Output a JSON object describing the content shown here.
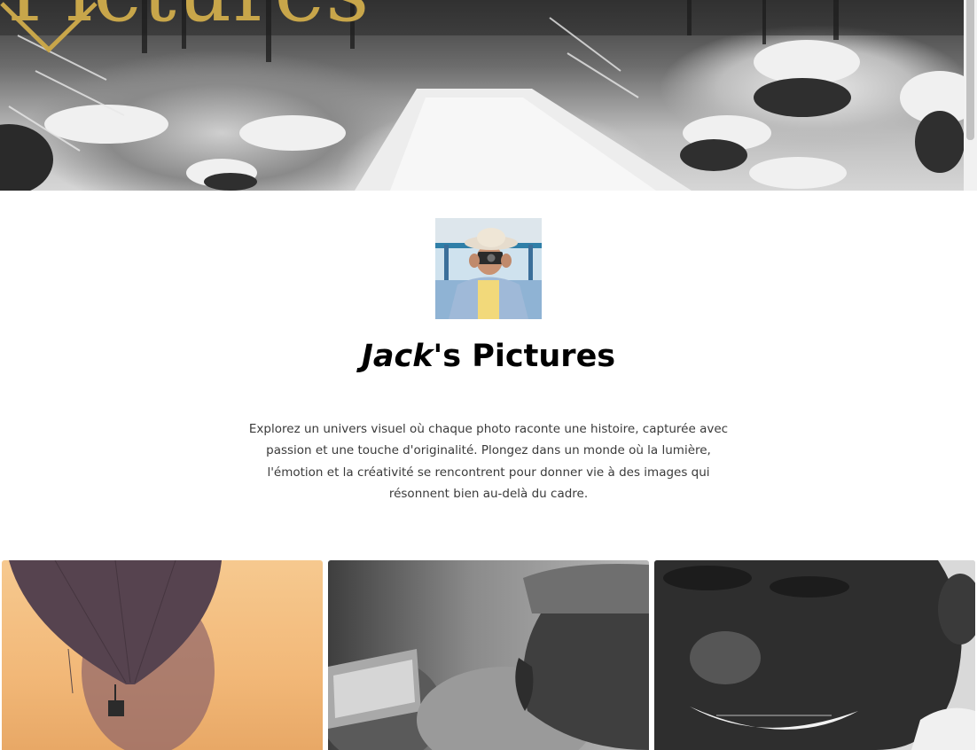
{
  "hero": {
    "title": "Pictures",
    "scroll_icon": "chevron-down-icon",
    "accent_color": "#c8a64a"
  },
  "profile": {
    "name": "Jack",
    "title_suffix": "'s Pictures",
    "description": "Explorez un univers visuel où chaque photo raconte une histoire, capturée avec passion et une touche d'originalité. Plongez dans un monde où la lumière, l'émotion et la créativité se rencontrent pour donner vie à des images qui résonnent bien au-delà du cadre."
  },
  "gallery": {
    "photos": [
      {
        "subject": "hot-air-balloons"
      },
      {
        "subject": "man-with-flat-cap"
      },
      {
        "subject": "smiling-man"
      }
    ]
  }
}
